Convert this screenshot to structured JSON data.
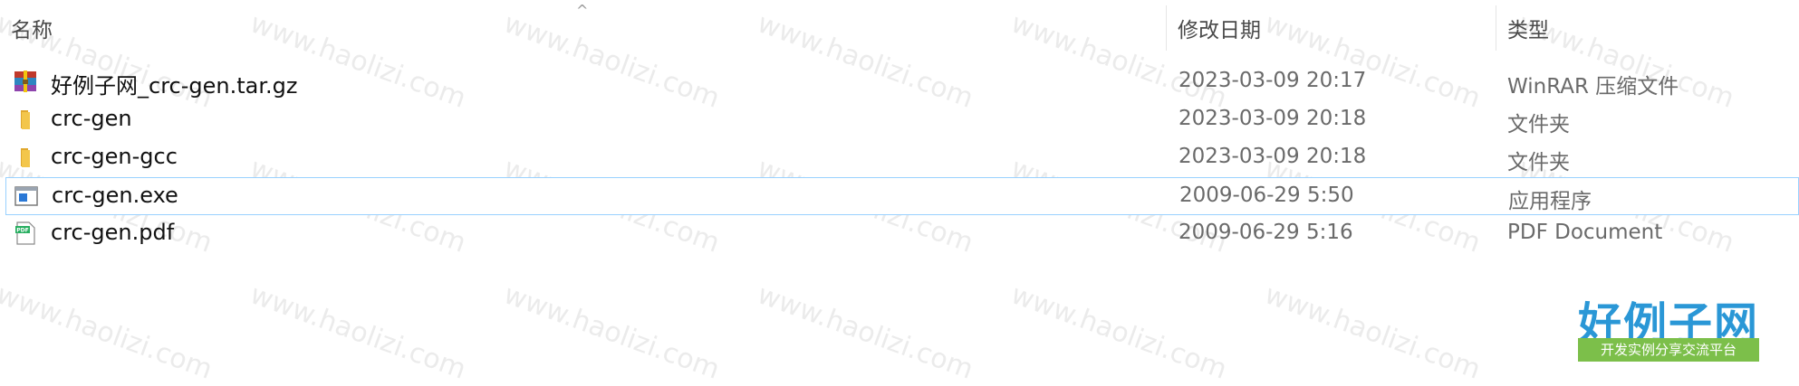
{
  "columns": {
    "name": "名称",
    "modified": "修改日期",
    "type": "类型"
  },
  "sort_indicator": "^",
  "files": [
    {
      "icon": "winrar-archive-icon",
      "name": "好例子网_crc-gen.tar.gz",
      "modified": "2023-03-09 20:17",
      "type": "WinRAR 压缩文件"
    },
    {
      "icon": "folder-icon",
      "name": "crc-gen",
      "modified": "2023-03-09 20:18",
      "type": "文件夹"
    },
    {
      "icon": "folder-icon",
      "name": "crc-gen-gcc",
      "modified": "2023-03-09 20:18",
      "type": "文件夹"
    },
    {
      "icon": "exe-icon",
      "name": "crc-gen.exe",
      "modified": "2009-06-29 5:50",
      "type": "应用程序"
    },
    {
      "icon": "pdf-icon",
      "name": "crc-gen.pdf",
      "modified": "2009-06-29 5:16",
      "type": "PDF Document"
    }
  ],
  "watermark": "www.haolizi.com",
  "logo": {
    "main": "好例子网",
    "sub": "开发实例分享交流平台"
  },
  "colors": {
    "selection_border": "#99d1ff",
    "folder": "#f3c64b",
    "logo_blue": "#2a97d6",
    "logo_green": "#7cbf4a"
  }
}
